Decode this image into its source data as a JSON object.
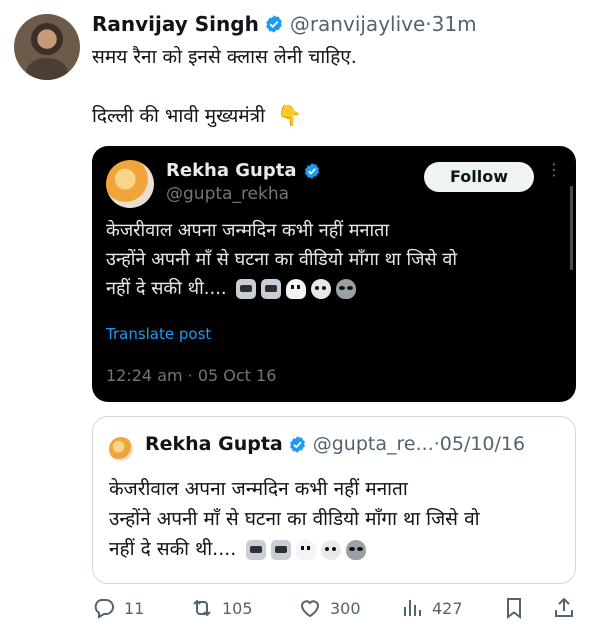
{
  "tweet": {
    "author_name": "Ranvijay Singh",
    "author_handle": "@ranvijaylive",
    "separator": "·",
    "time": "31m",
    "text_line1": "समय रैना को इनसे क्लास लेनी चाहिए.",
    "text_line2": "दिल्ली की भावी मुख्यमंत्री",
    "text_emoji": "👇"
  },
  "embedded_screenshot": {
    "author_name": "Rekha Gupta",
    "author_handle": "@gupta_rekha",
    "follow_label": "Follow",
    "more_icon": "⋮",
    "text_line1": "केजरीवाल अपना जन्मदिन कभी नहीं मनाता",
    "text_line2": "उन्होंने अपनी माँ से घटना का वीडियो माँगा था जिसे वो",
    "text_line3": "नहीं दे सकी थी....",
    "translate_label": "Translate post",
    "timestamp": "12:24 am · 05 Oct 16"
  },
  "quoted_tweet": {
    "author_name": "Rekha Gupta",
    "author_handle": "@gupta_re...",
    "separator": "·",
    "date": "05/10/16",
    "text_line1": "केजरीवाल अपना जन्मदिन कभी नहीं मनाता",
    "text_line2": "उन्होंने अपनी माँ से घटना का वीडियो माँगा था जिसे वो",
    "text_line3": "नहीं दे सकी थी...."
  },
  "actions": {
    "replies": "11",
    "reposts": "105",
    "likes": "300",
    "views": "427"
  },
  "colors": {
    "text": "#0f1419",
    "secondary": "#536471",
    "verified": "#1d9bf0",
    "dark_bg": "#000000",
    "border": "#cfd9de"
  },
  "icons": [
    "verified-badge-icon",
    "point-down-emoji",
    "robot-emoji",
    "ghost-emoji",
    "skull-emoji",
    "alien-emoji",
    "reply-icon",
    "repost-icon",
    "like-icon",
    "views-icon",
    "bookmark-icon",
    "share-icon"
  ]
}
